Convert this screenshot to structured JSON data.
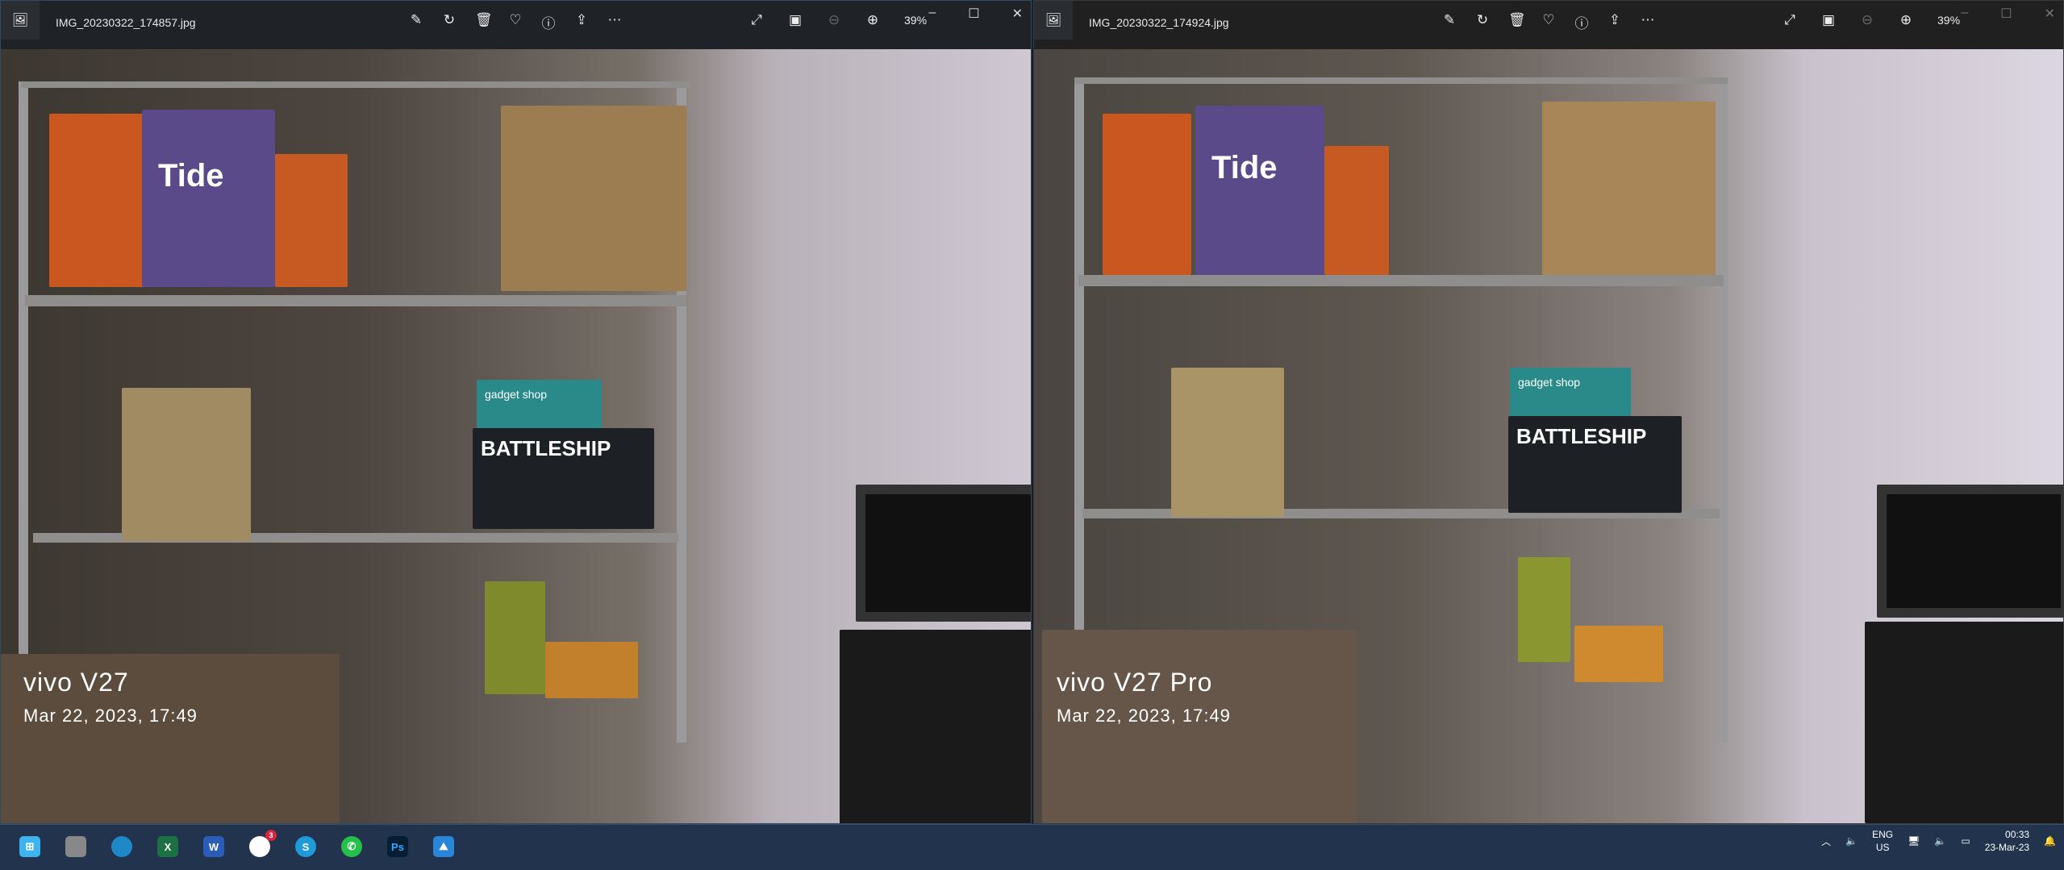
{
  "windows": [
    {
      "filename": "IMG_20230322_174857.jpg",
      "zoom": "39%",
      "watermark_model": "vivo V27",
      "watermark_date": "Mar 22, 2023, 17:49"
    },
    {
      "filename": "IMG_20230322_174924.jpg",
      "zoom": "39%",
      "watermark_model": "vivo V27 Pro",
      "watermark_date": "Mar 22, 2023, 17:49"
    }
  ],
  "taskbar": {
    "slack_badge": "3",
    "lang": "ENG",
    "region": "US",
    "time": "00:33",
    "date": "23-Mar-23",
    "ps_label": "Ps",
    "excel_label": "X",
    "word_label": "W",
    "skype_label": "S"
  },
  "photo_labels": {
    "tide": "Tide",
    "battleship": "BATTLESHIP",
    "gadget": "gadget shop"
  }
}
